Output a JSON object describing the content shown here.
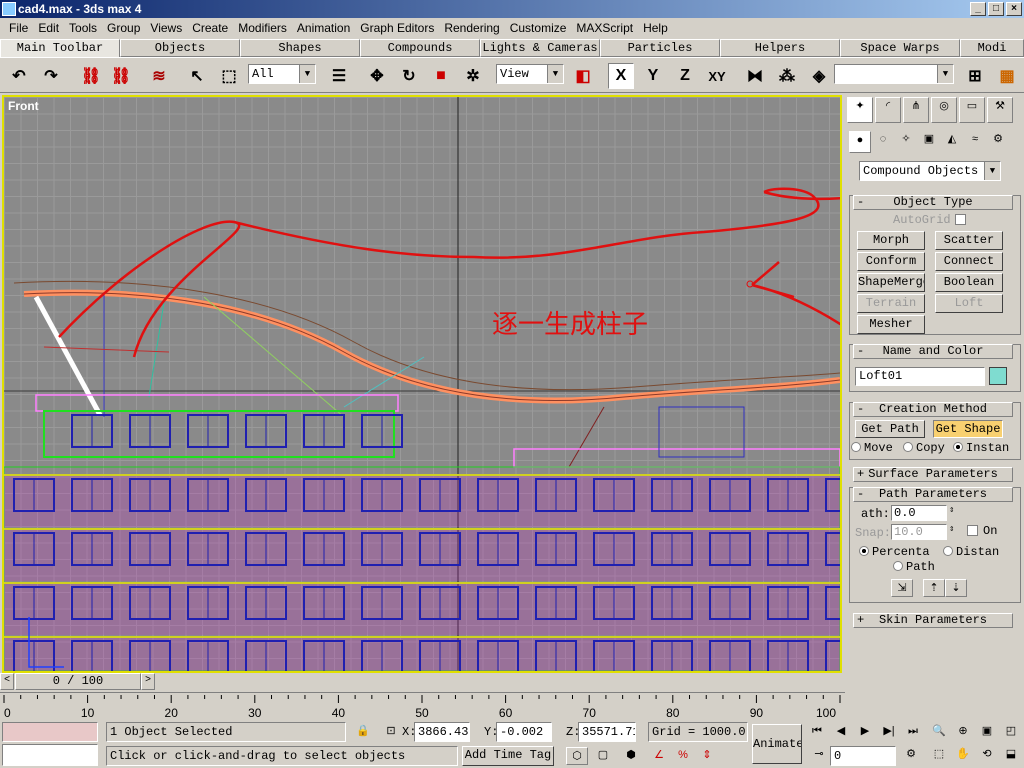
{
  "window": {
    "title": "cad4.max - 3ds max 4",
    "min": "_",
    "max": "□",
    "close": "×"
  },
  "menu": [
    "File",
    "Edit",
    "Tools",
    "Group",
    "Views",
    "Create",
    "Modifiers",
    "Animation",
    "Graph Editors",
    "Rendering",
    "Customize",
    "MAXScript",
    "Help"
  ],
  "tabs": [
    "Main Toolbar",
    "Objects",
    "Shapes",
    "Compounds",
    "Lights & Cameras",
    "Particles",
    "Helpers",
    "Space Warps",
    "Modi"
  ],
  "toolbar": {
    "selection_filter": "All",
    "coord_system": "View",
    "axis_x": "X",
    "axis_y": "Y",
    "axis_z": "Z",
    "axis_xy": "XY",
    "named_sel": ""
  },
  "viewport": {
    "label": "Front",
    "annotation": "逐一生成柱子"
  },
  "timeslider": {
    "position": "0 / 100",
    "left": "<",
    "right": ">"
  },
  "trackbar": {
    "ticks": [
      "0",
      "10",
      "20",
      "30",
      "40",
      "50",
      "60",
      "70",
      "80",
      "90",
      "100"
    ]
  },
  "status": {
    "selected": "1 Object Selected",
    "prompt": "Click or click-and-drag to select objects",
    "x_label": "X:",
    "x": "3866.435",
    "y_label": "Y:",
    "y": "-0.002",
    "z_label": "Z:",
    "z": "35571.71",
    "grid": "Grid = 1000.0",
    "add_time_tag": "Add Time Tag",
    "animate": "Animate",
    "frame": "0"
  },
  "panel": {
    "category": "Compound Objects",
    "object_type": {
      "title": "Object Type",
      "autogrid": "AutoGrid",
      "buttons": [
        "Morph",
        "Scatter",
        "Conform",
        "Connect",
        "ShapeMerge",
        "Boolean",
        "Terrain",
        "Loft",
        "Mesher"
      ]
    },
    "name_color": {
      "title": "Name and Color",
      "name": "Loft01",
      "color": "#7fdcd0"
    },
    "creation": {
      "title": "Creation Method",
      "get_path": "Get Path",
      "get_shape": "Get Shape",
      "move": "Move",
      "copy": "Copy",
      "instance": "Instan"
    },
    "surface": {
      "title": "Surface Parameters"
    },
    "path_params": {
      "title": "Path Parameters",
      "path_label": "ath:",
      "path_value": "0.0",
      "snap_label": "Snap:",
      "snap_value": "10.0",
      "on": "On",
      "percentage": "Percenta",
      "distance": "Distan",
      "path_steps": "Path"
    },
    "skin": {
      "title": "Skin Parameters"
    }
  }
}
